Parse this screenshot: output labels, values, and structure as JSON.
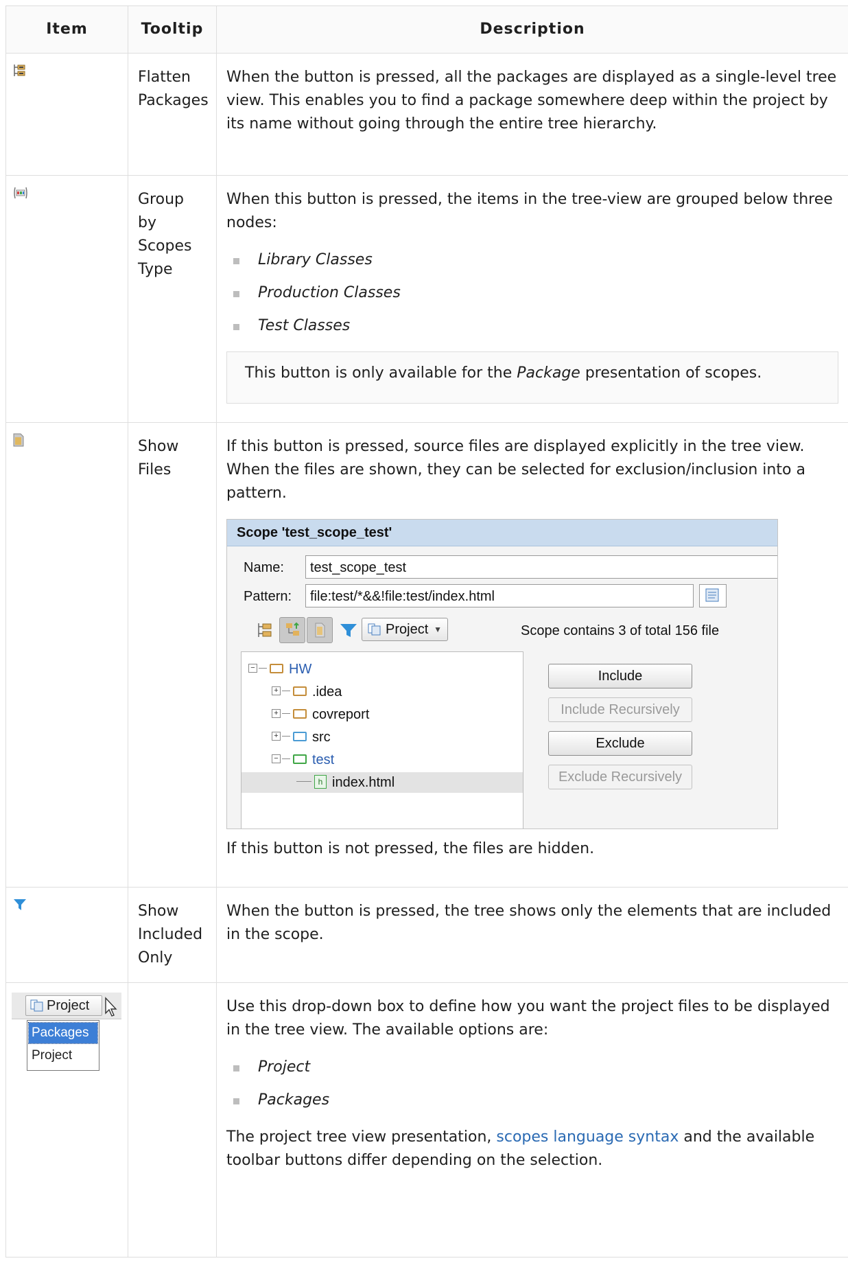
{
  "headers": {
    "item": "Item",
    "tooltip": "Tooltip",
    "description": "Description"
  },
  "rows": [
    {
      "icon": "flatten-packages-icon",
      "tooltip": "Flatten Packages",
      "description": "When the button is pressed, all the packages are displayed as a single-level tree view. This enables you to find a package somewhere deep within the project by its name without going through the entire tree hierarchy."
    },
    {
      "icon": "group-by-scopes-type-icon",
      "tooltip": "Group by Scopes Type",
      "description": "When this button is pressed, the items in the tree-view are grouped below three nodes:",
      "bullets": [
        "Library Classes",
        "Production Classes",
        "Test Classes"
      ],
      "note_before": "This button is only available for the ",
      "note_italic": "Package",
      "note_after": " presentation of scopes."
    },
    {
      "icon": "show-files-icon",
      "tooltip": "Show Files",
      "description": "If this button is pressed, source files are displayed explicitly in the tree view. When the files are shown, they can be selected for exclusion/inclusion into a pattern.",
      "after": "If this button is not pressed, the files are hidden.",
      "dialog": {
        "title": "Scope 'test_scope_test'",
        "name_label": "Name:",
        "name_value": "test_scope_test",
        "pattern_label": "Pattern:",
        "pattern_value": "file:test/*&&!file:test/index.html",
        "combo": "Project",
        "scope_info": "Scope contains 3 of total 156 file",
        "tree": [
          "HW",
          ".idea",
          "covreport",
          "src",
          "test",
          "index.html"
        ],
        "buttons": [
          "Include",
          "Include Recursively",
          "Exclude",
          "Exclude Recursively"
        ]
      }
    },
    {
      "icon": "filter-icon",
      "tooltip": "Show Included Only",
      "description": "When the button is pressed, the tree shows only the elements that are included in the scope."
    },
    {
      "icon": "project-dropdown",
      "dropdown": {
        "value": "Project",
        "options": [
          "Packages",
          "Project"
        ]
      },
      "tooltip": "",
      "description": "Use this drop-down box to define how you want the project files to be displayed in the tree view. The available options are:",
      "bullets": [
        "Project",
        "Packages"
      ],
      "closing_before": "The project tree view presentation, ",
      "closing_link": "scopes language syntax",
      "closing_after": " and the available toolbar buttons differ depending on the selection."
    }
  ],
  "colors": {
    "link": "#2a6ab3",
    "dialog_title_bg": "#c9dbee",
    "filter_icon": "#2f8fd8",
    "border": "#dedede"
  }
}
